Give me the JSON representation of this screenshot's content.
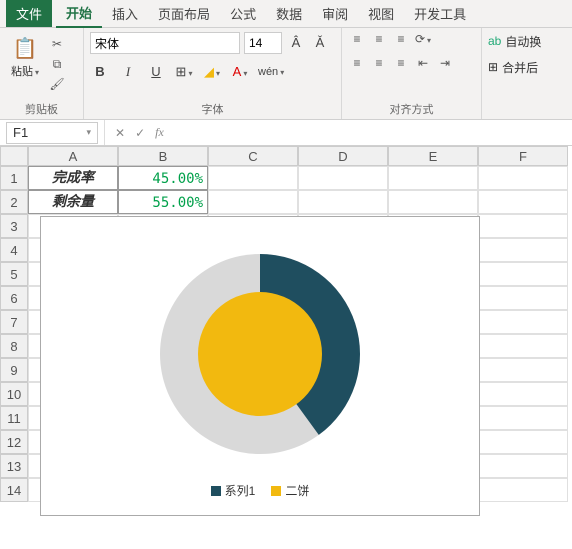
{
  "tabs": {
    "file": "文件",
    "home": "开始",
    "insert": "插入",
    "layout": "页面布局",
    "formulas": "公式",
    "data": "数据",
    "review": "审阅",
    "view": "视图",
    "dev": "开发工具"
  },
  "ribbon": {
    "paste_label": "粘贴",
    "clipboard_group": "剪贴板",
    "font_name": "宋体",
    "font_size": "14",
    "font_group": "字体",
    "wrap_text": "自动换",
    "merge": "合并后",
    "align_group": "对齐方式"
  },
  "fbar": {
    "namebox": "F1",
    "formula": ""
  },
  "cols": [
    "A",
    "B",
    "C",
    "D",
    "E",
    "F"
  ],
  "rows": [
    "1",
    "2",
    "3",
    "4",
    "5",
    "6",
    "7",
    "8",
    "9",
    "10",
    "11",
    "12",
    "13",
    "14"
  ],
  "cells": {
    "A1": "完成率",
    "B1": "45.00%",
    "A2": "剩余量",
    "B2": "55.00%"
  },
  "legend": {
    "s1": "系列1",
    "s2": "二饼"
  },
  "colors": {
    "series_dark": "#1f4e5f",
    "series_grey": "#d9d9d9",
    "series_yellow": "#f2b90f"
  },
  "chart_data": {
    "type": "pie",
    "title": "",
    "series": [
      {
        "name": "系列1",
        "categories": [
          "完成率",
          "剩余量"
        ],
        "values": [
          45,
          55
        ],
        "colors": [
          "#1f4e5f",
          "#d9d9d9"
        ]
      },
      {
        "name": "二饼",
        "values": [
          100
        ],
        "colors": [
          "#f2b90f"
        ]
      }
    ],
    "legend_position": "bottom"
  }
}
